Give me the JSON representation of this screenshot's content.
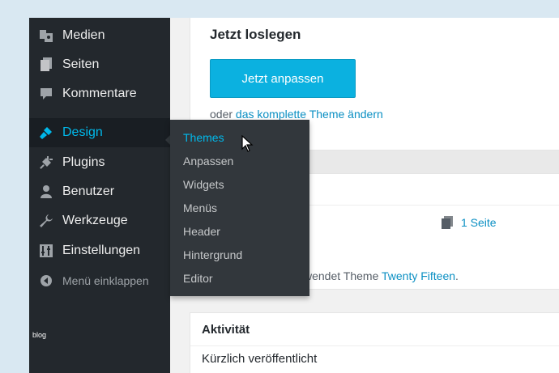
{
  "sidebar": {
    "items": [
      {
        "label": "Medien",
        "icon": "media-icon"
      },
      {
        "label": "Seiten",
        "icon": "pages-icon"
      },
      {
        "label": "Kommentare",
        "icon": "comments-icon"
      },
      {
        "label": "Design",
        "icon": "brush-icon",
        "active": true
      },
      {
        "label": "Plugins",
        "icon": "plugin-icon"
      },
      {
        "label": "Benutzer",
        "icon": "user-icon"
      },
      {
        "label": "Werkzeuge",
        "icon": "wrench-icon"
      },
      {
        "label": "Einstellungen",
        "icon": "settings-icon"
      }
    ],
    "collapse_label": "Menü einklappen"
  },
  "flyout": {
    "items": [
      "Themes",
      "Anpassen",
      "Widgets",
      "Menüs",
      "Header",
      "Hintergrund",
      "Editor"
    ],
    "current": "Themes"
  },
  "welcome": {
    "title": "Jetzt loslegen",
    "cta_label": "Jetzt anpassen",
    "change_prefix": "oder ",
    "change_link": "das komplette Theme ändern"
  },
  "glance": {
    "pages_label": "1 Seite",
    "theme_prefix": "wendet Theme ",
    "theme_name": "Twenty Fifteen",
    "theme_suffix": "."
  },
  "activity": {
    "title": "Aktivität",
    "subtitle": "Kürzlich veröffentlicht"
  },
  "watermark": "blog",
  "colors": {
    "sidebar_bg": "#23282d",
    "flyout_bg": "#32373c",
    "accent": "#00b9eb",
    "button": "#0bb1e0",
    "link": "#0a8fc3"
  }
}
